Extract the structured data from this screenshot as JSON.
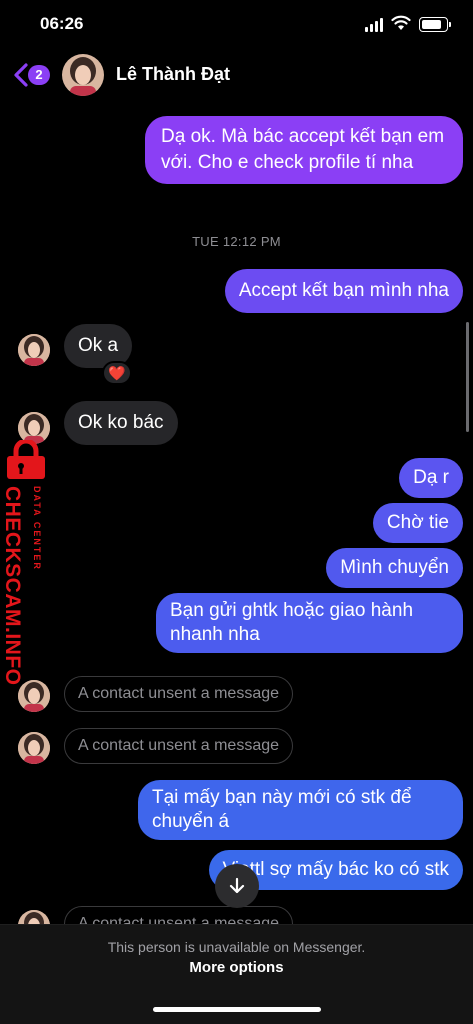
{
  "status_bar": {
    "time": "06:26",
    "battery_level": 0.85
  },
  "header": {
    "back_badge": "2",
    "contact_name": "Lê Thành Đạt"
  },
  "timestamp": "TUE 12:12 PM",
  "messages": [
    {
      "text": "Dạ ok. Mà bác accept kết bạn em với. Cho e check profile tí nha",
      "color": "#8b3ff5"
    },
    {
      "text": "Accept kết bạn mình nha",
      "color": "#6c4cf2"
    },
    {
      "text": "Ok a"
    },
    {
      "reaction": "❤️"
    },
    {
      "text": "Ok ko bác"
    },
    {
      "text": "Dạ r",
      "color": "#5b55f0"
    },
    {
      "text": "Chờ tie",
      "color": "#5658ef"
    },
    {
      "text": "Mình chuyển",
      "color": "#5159ee"
    },
    {
      "text": "Bạn gửi ghtk hoặc giao hành nhanh nha",
      "color": "#4c5cee"
    },
    {
      "text": "A contact unsent a message"
    },
    {
      "text": "A contact unsent a message"
    },
    {
      "text": "Tại mấy bạn này mới có stk để chuyển á",
      "color": "#3f66ec"
    },
    {
      "text": "Viettl sợ mấy bác ko có stk",
      "color": "#3a6aeb"
    },
    {
      "text": "A contact unsent a message"
    }
  ],
  "watermark": {
    "main": "CHECKSCAM.INFO",
    "sub": "DATA CENTER"
  },
  "footer": {
    "notice": "This person is unavailable on Messenger.",
    "link": "More options"
  }
}
